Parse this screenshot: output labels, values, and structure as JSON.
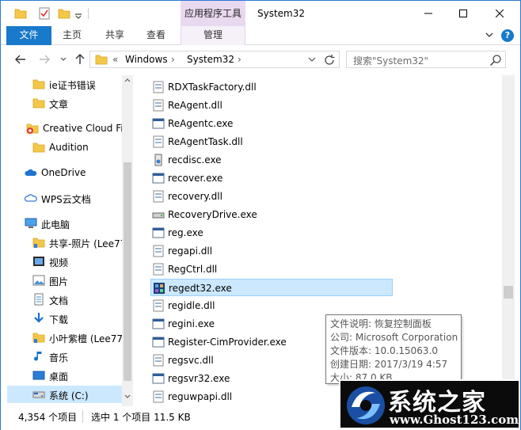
{
  "titlebar": {
    "context_tab": "应用程序工具",
    "title": "System32"
  },
  "ribbon": {
    "file": "文件",
    "home": "主页",
    "share": "共享",
    "view": "查看",
    "manage": "管理"
  },
  "address": {
    "overflow": "«",
    "crumbs": [
      "Windows",
      "System32"
    ],
    "search_placeholder": "搜索\"System32\""
  },
  "nav_pane": {
    "items": [
      {
        "label": "ie证书错误",
        "icon": "folder-icon"
      },
      {
        "label": "文章",
        "icon": "folder-icon"
      },
      {
        "label": "Creative Cloud Fil",
        "icon": "creative-cloud-icon"
      },
      {
        "label": "Audition",
        "icon": "folder-icon"
      },
      {
        "label": "OneDrive",
        "icon": "onedrive-icon"
      },
      {
        "label": "WPS云文档",
        "icon": "wps-cloud-icon"
      },
      {
        "label": "此电脑",
        "icon": "computer-icon"
      },
      {
        "label": "共享-照片 (Lee77",
        "icon": "shared-folder-icon"
      },
      {
        "label": "视频",
        "icon": "video-icon"
      },
      {
        "label": "图片",
        "icon": "pictures-icon"
      },
      {
        "label": "文档",
        "icon": "documents-icon"
      },
      {
        "label": "下载",
        "icon": "download-icon"
      },
      {
        "label": "小叶紫檀 (Lee77",
        "icon": "shared-folder-icon"
      },
      {
        "label": "音乐",
        "icon": "music-icon"
      },
      {
        "label": "桌面",
        "icon": "desktop-icon"
      },
      {
        "label": "系统 (C:)",
        "icon": "drive-icon"
      }
    ]
  },
  "files": [
    {
      "name": "RDXTaskFactory.dll",
      "icon": "dll-icon"
    },
    {
      "name": "ReAgent.dll",
      "icon": "dll-icon"
    },
    {
      "name": "ReAgentc.exe",
      "icon": "exe-icon"
    },
    {
      "name": "ReAgentTask.dll",
      "icon": "dll-icon"
    },
    {
      "name": "recdisc.exe",
      "icon": "recdisc-icon"
    },
    {
      "name": "recover.exe",
      "icon": "exe-icon"
    },
    {
      "name": "recovery.dll",
      "icon": "dll-icon"
    },
    {
      "name": "RecoveryDrive.exe",
      "icon": "recovery-drive-icon"
    },
    {
      "name": "reg.exe",
      "icon": "exe-icon"
    },
    {
      "name": "regapi.dll",
      "icon": "dll-icon"
    },
    {
      "name": "RegCtrl.dll",
      "icon": "dll-icon"
    },
    {
      "name": "regedt32.exe",
      "icon": "regedit-icon"
    },
    {
      "name": "regidle.dll",
      "icon": "dll-icon"
    },
    {
      "name": "regini.exe",
      "icon": "exe-icon"
    },
    {
      "name": "Register-CimProvider.exe",
      "icon": "exe-icon"
    },
    {
      "name": "regsvc.dll",
      "icon": "dll-icon"
    },
    {
      "name": "regsvr32.exe",
      "icon": "exe-icon"
    },
    {
      "name": "reguwpapi.dll",
      "icon": "dll-icon"
    }
  ],
  "tooltip": {
    "lines": [
      "文件说明: 恢复控制面板",
      "公司: Microsoft Corporation",
      "文件版本: 10.0.15063.0",
      "创建日期: 2017/3/19 4:57",
      "大小: 87.0 KB"
    ]
  },
  "status": {
    "count": "4,354 个项目",
    "selection": "选中 1 个项目  11.5 KB"
  },
  "watermark": {
    "title": "系统之家",
    "url": "www.Ghost123.com"
  },
  "colors": {
    "accent": "#1979ca",
    "selection": "#cce8ff",
    "context_tab": "#e9d9f0"
  }
}
